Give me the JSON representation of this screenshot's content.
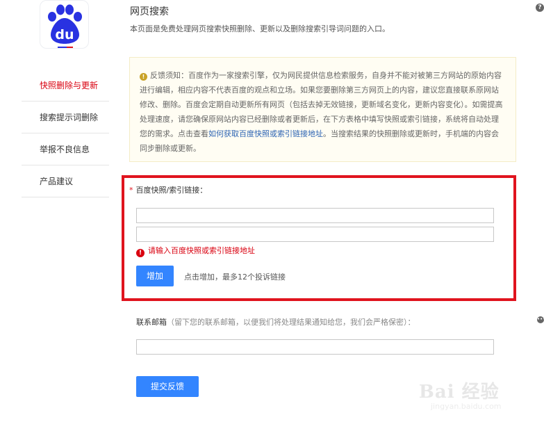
{
  "header": {
    "title": "网页搜索",
    "subtitle": "本页面是免费处理网页搜索快照删除、更新以及删除搜索引导词问题的入口。",
    "help_icon": "?"
  },
  "logo": {
    "text": "du",
    "icon": "baidu-paw-logo",
    "color": "#2932e1"
  },
  "sidebar": {
    "items": [
      {
        "label": "快照删除与更新",
        "active": true
      },
      {
        "label": "搜索提示词删除",
        "active": false
      },
      {
        "label": "举报不良信息",
        "active": false
      },
      {
        "label": "产品建议",
        "active": false
      }
    ]
  },
  "notice": {
    "icon": "!",
    "prefix": "反馈须知：百度作为一家搜索引擎，仅为网民提供信息检索服务，自身并不能对被第三方网站的原始内容进行编辑，相应内容不代表百度的观点和立场。如果您要删除第三方网页上的内容，建议您直接联系原网站修改、删除。百度会定期自动更新所有网页（包括去掉无效链接，更新域名变化，更新内容变化）。如需提高处理速度，请您确保原网站内容已经删除或者更新后，在下方表格中填写快照或索引链接，系统将自动处理您的需求。点击查看",
    "link": "如何获取百度快照或索引链接地址",
    "suffix": "。当搜索结果的快照删除或更新时，手机端的内容会同步删除或更新。"
  },
  "form": {
    "required_star": "*",
    "link_label": "百度快照/索引链接：",
    "link_inputs": [
      {
        "value": "",
        "placeholder": ""
      },
      {
        "value": "",
        "placeholder": ""
      }
    ],
    "error_icon": "!",
    "error_text": "请输入百度快照或索引链接地址",
    "add_button": "增加",
    "add_hint": "点击增加，最多12个投诉链接",
    "email_label": "联系邮箱",
    "email_hint": "（留下您的联系邮箱，以便我们将处理结果通知给您，我们会严格保密）：",
    "email_value": "",
    "submit_button": "提交反馈"
  },
  "side_more_icon": "•••",
  "watermark": {
    "brand": "Bai 经验",
    "url": "jingyan.baidu.com"
  },
  "colors": {
    "accent": "#3385ff",
    "error": "#e0141e",
    "active_nav": "#d9000f",
    "link": "#2d64b3"
  }
}
